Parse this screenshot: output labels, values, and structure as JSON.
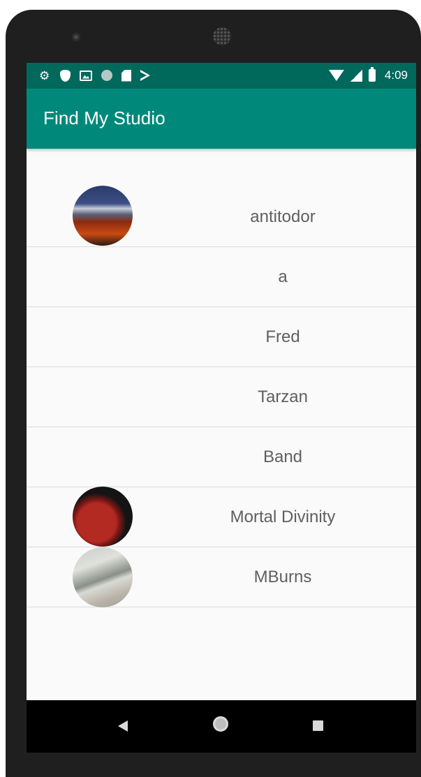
{
  "status_bar": {
    "time": "4:09",
    "left_icons": [
      "gear-icon",
      "shield-icon",
      "image-icon",
      "circle-icon",
      "sd-card-icon",
      "play-store-icon"
    ],
    "right_icons": [
      "wifi-icon",
      "signal-icon",
      "battery-icon"
    ]
  },
  "app_bar": {
    "title": "Find My Studio"
  },
  "studios": [
    {
      "name": "antitodor",
      "avatar": "photo"
    },
    {
      "name": "a",
      "avatar": null
    },
    {
      "name": "Fred",
      "avatar": null
    },
    {
      "name": "Tarzan",
      "avatar": null
    },
    {
      "name": "Band",
      "avatar": null
    },
    {
      "name": "Mortal Divinity",
      "avatar": "photo"
    },
    {
      "name": "MBurns",
      "avatar": "photo"
    }
  ],
  "nav_bar": {
    "buttons": [
      "back-icon",
      "home-icon",
      "recents-icon"
    ]
  },
  "colors": {
    "status_bar": "#00695c",
    "app_bar": "#00897b",
    "list_background": "#fafafa",
    "list_text": "#5f5f5f",
    "divider": "#dcdcdc"
  }
}
